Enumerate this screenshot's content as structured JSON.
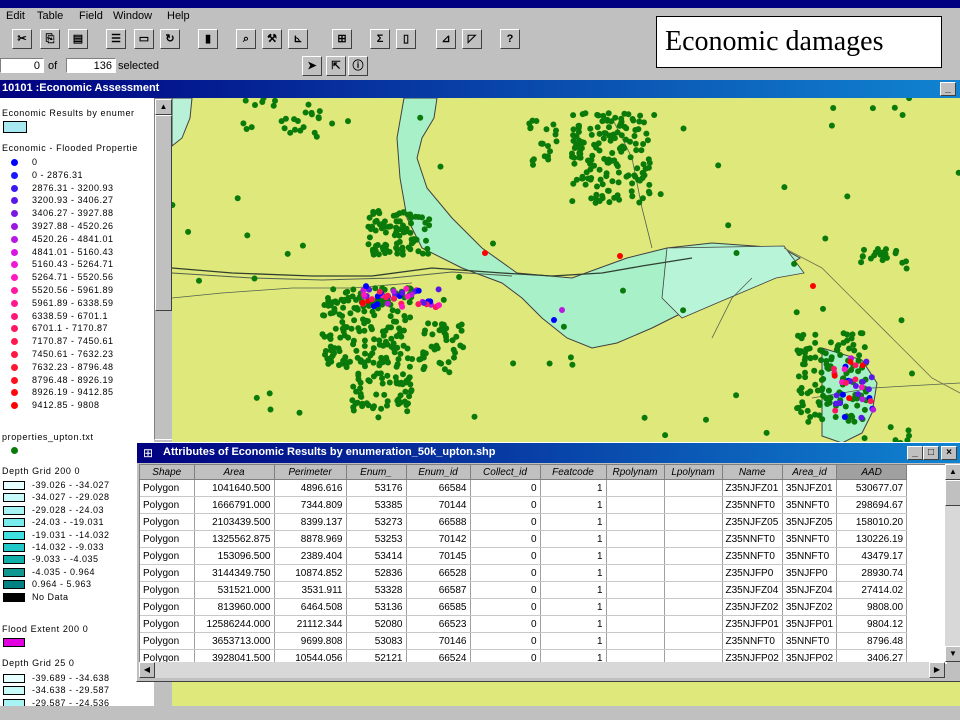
{
  "app": {
    "title": ""
  },
  "menu": [
    "Edit",
    "Table",
    "Field",
    "Window",
    "Help"
  ],
  "selection": {
    "selected_count": "0",
    "of_label": "of",
    "total": "136",
    "selected_label": "selected"
  },
  "caption": "Economic damages",
  "view_window": {
    "title": "10101 :Economic Assessment"
  },
  "legend": {
    "layer1_title": "Economic Results by enumer",
    "layer2_title": "Economic - Flooded Propertie",
    "classes": [
      {
        "label": "0",
        "color": "#0000ff"
      },
      {
        "label": "0 - 2876.31",
        "color": "#1818ff"
      },
      {
        "label": "2876.31 - 3200.93",
        "color": "#3a18f0"
      },
      {
        "label": "3200.93 - 3406.27",
        "color": "#5a18e8"
      },
      {
        "label": "3406.27 - 3927.88",
        "color": "#7a18e0"
      },
      {
        "label": "3927.88 - 4520.26",
        "color": "#9a18e0"
      },
      {
        "label": "4520.26 - 4841.01",
        "color": "#b818e0"
      },
      {
        "label": "4841.01 - 5160.43",
        "color": "#d818e0"
      },
      {
        "label": "5160.43 - 5264.71",
        "color": "#f018d8"
      },
      {
        "label": "5264.71 - 5520.56",
        "color": "#ff18c0"
      },
      {
        "label": "5520.56 - 5961.89",
        "color": "#ff18a0"
      },
      {
        "label": "5961.89 - 6338.59",
        "color": "#ff1890"
      },
      {
        "label": "6338.59 - 6701.1",
        "color": "#ff1878"
      },
      {
        "label": "6701.1 - 7170.87",
        "color": "#ff1860"
      },
      {
        "label": "7170.87 - 7450.61",
        "color": "#ff1850"
      },
      {
        "label": "7450.61 - 7632.23",
        "color": "#ff1840"
      },
      {
        "label": "7632.23 - 8796.48",
        "color": "#ff1830"
      },
      {
        "label": "8796.48 - 8926.19",
        "color": "#ff1020"
      },
      {
        "label": "8926.19 - 9412.85",
        "color": "#ff0810"
      },
      {
        "label": "9412.85 - 9808",
        "color": "#ff0000"
      }
    ],
    "layer3_title": "properties_upton.txt",
    "layer4_title": "Depth Grid 200 0",
    "depth200": [
      {
        "label": "-39.026 - -34.027",
        "color": "#e8ffff"
      },
      {
        "label": "-34.027 - -29.028",
        "color": "#c8fafa"
      },
      {
        "label": "-29.028 - -24.03",
        "color": "#a8f4f4"
      },
      {
        "label": "-24.03 - -19.031",
        "color": "#78ecec"
      },
      {
        "label": "-19.031 - -14.032",
        "color": "#40e0e0"
      },
      {
        "label": "-14.032 - -9.033",
        "color": "#20c8c8"
      },
      {
        "label": "-9.033 - -4.035",
        "color": "#10b0a8"
      },
      {
        "label": "-4.035 - 0.964",
        "color": "#109890"
      },
      {
        "label": "0.964 - 5.963",
        "color": "#008080"
      },
      {
        "label": "No Data",
        "color": "#000000"
      }
    ],
    "layer5_title": "Flood Extent 200 0",
    "flood_color": "#e000e0",
    "layer6_title": "Depth Grid 25 0",
    "depth25": [
      {
        "label": "-39.689 - -34.638",
        "color": "#e8ffff"
      },
      {
        "label": "-34.638 - -29.587",
        "color": "#c8fafa"
      },
      {
        "label": "-29.587 - -24.536",
        "color": "#a8f4f4"
      }
    ]
  },
  "attributes": {
    "title": "Attributes of Economic Results by enumeration_50k_upton.shp",
    "columns": [
      "Shape",
      "Area",
      "Perimeter",
      "Enum_",
      "Enum_id",
      "Collect_id",
      "Featcode",
      "Rpolynam",
      "Lpolynam",
      "Name",
      "Area_id",
      "AAD"
    ],
    "rows": [
      [
        "Polygon",
        "1041640.500",
        "4896.616",
        "53176",
        "66584",
        "0",
        "1",
        "",
        "",
        "Z35NJFZ01",
        "35NJFZ01",
        "530677.07"
      ],
      [
        "Polygon",
        "1666791.000",
        "7344.809",
        "53385",
        "70144",
        "0",
        "1",
        "",
        "",
        "Z35NNFT0",
        "35NNFT0",
        "298694.67"
      ],
      [
        "Polygon",
        "2103439.500",
        "8399.137",
        "53273",
        "66588",
        "0",
        "1",
        "",
        "",
        "Z35NJFZ05",
        "35NJFZ05",
        "158010.20"
      ],
      [
        "Polygon",
        "1325562.875",
        "8878.969",
        "53253",
        "70142",
        "0",
        "1",
        "",
        "",
        "Z35NNFT0",
        "35NNFT0",
        "130226.19"
      ],
      [
        "Polygon",
        "153096.500",
        "2389.404",
        "53414",
        "70145",
        "0",
        "1",
        "",
        "",
        "Z35NNFT0",
        "35NNFT0",
        "43479.17"
      ],
      [
        "Polygon",
        "3144349.750",
        "10874.852",
        "52836",
        "66528",
        "0",
        "1",
        "",
        "",
        "Z35NJFP0",
        "35NJFP0",
        "28930.74"
      ],
      [
        "Polygon",
        "531521.000",
        "3531.911",
        "53328",
        "66587",
        "0",
        "1",
        "",
        "",
        "Z35NJFZ04",
        "35NJFZ04",
        "27414.02"
      ],
      [
        "Polygon",
        "813960.000",
        "6464.508",
        "53136",
        "66585",
        "0",
        "1",
        "",
        "",
        "Z35NJFZ02",
        "35NJFZ02",
        "9808.00"
      ],
      [
        "Polygon",
        "12586244.000",
        "21112.344",
        "52080",
        "66523",
        "0",
        "1",
        "",
        "",
        "Z35NJFP01",
        "35NJFP01",
        "9804.12"
      ],
      [
        "Polygon",
        "3653713.000",
        "9699.808",
        "53083",
        "70146",
        "0",
        "1",
        "",
        "",
        "Z35NNFT0",
        "35NNFT0",
        "8796.48"
      ],
      [
        "Polygon",
        "3928041.500",
        "10544.056",
        "52121",
        "66524",
        "0",
        "1",
        "",
        "",
        "Z35NJFP02",
        "35NJFP02",
        "3406.27"
      ]
    ]
  },
  "colors": {
    "land": "#dfe87a",
    "flood_zone": "#a8f0c8",
    "property_green": "#0a7a0a",
    "title_blue": "#000080"
  }
}
